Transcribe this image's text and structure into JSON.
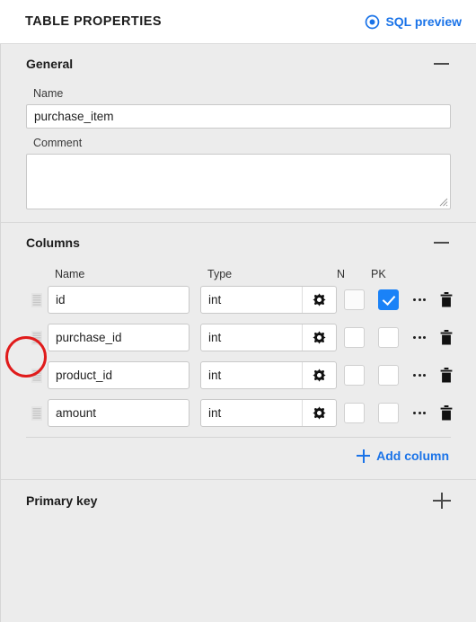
{
  "header": {
    "title": "TABLE PROPERTIES",
    "sql_preview_label": "SQL preview",
    "sql_preview_icon": "eye-ring-icon",
    "accent_color": "#1a73e8"
  },
  "sections": {
    "general": {
      "title": "General",
      "collapse_icon": "minus-icon",
      "name_label": "Name",
      "name_value": "purchase_item",
      "name_placeholder": "",
      "comment_label": "Comment",
      "comment_value": "",
      "comment_placeholder": ""
    },
    "columns": {
      "title": "Columns",
      "collapse_icon": "minus-icon",
      "headers": {
        "name": "Name",
        "type": "Type",
        "n": "N",
        "pk": "PK"
      },
      "rows": [
        {
          "handle_icon": "drag-handle-icon",
          "name": "id",
          "type": "int",
          "type_settings_icon": "gear-icon",
          "n_checked": false,
          "pk_checked": true,
          "more_icon": "more-dots-icon",
          "delete_icon": "trash-icon"
        },
        {
          "handle_icon": "drag-handle-icon",
          "name": "purchase_id",
          "type": "int",
          "type_settings_icon": "gear-icon",
          "n_checked": false,
          "pk_checked": false,
          "more_icon": "more-dots-icon",
          "delete_icon": "trash-icon"
        },
        {
          "handle_icon": "drag-handle-icon",
          "name": "product_id",
          "type": "int",
          "type_settings_icon": "gear-icon",
          "n_checked": false,
          "pk_checked": false,
          "more_icon": "more-dots-icon",
          "delete_icon": "trash-icon"
        },
        {
          "handle_icon": "drag-handle-icon",
          "name": "amount",
          "type": "int",
          "type_settings_icon": "gear-icon",
          "n_checked": false,
          "pk_checked": false,
          "more_icon": "more-dots-icon",
          "delete_icon": "trash-icon"
        }
      ],
      "add_column_label": "Add column",
      "add_column_icon": "plus-icon"
    },
    "primary_key": {
      "title": "Primary key",
      "expand_icon": "plus-icon"
    }
  },
  "annotation": {
    "shape": "circle",
    "color": "#e01b1b",
    "target": "drag-handle-icon-row-1"
  }
}
